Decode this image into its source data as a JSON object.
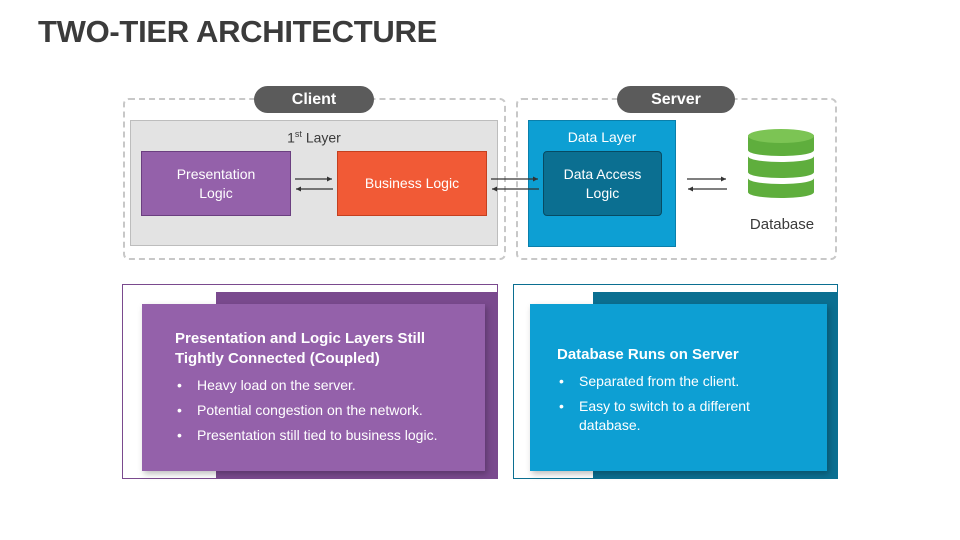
{
  "title": "TWO-TIER ARCHITECTURE",
  "client": {
    "label": "Client",
    "layer_label_pre": "1",
    "layer_label_sup": "st",
    "layer_label_post": " Layer",
    "presentation": "Presentation Logic",
    "business": "Business Logic"
  },
  "server": {
    "label": "Server",
    "layer_label": "Data Layer",
    "data_access": "Data Access Logic",
    "database": "Database"
  },
  "cards": {
    "left": {
      "title": "Presentation and Logic Layers Still Tightly Connected (Coupled)",
      "items": [
        "Heavy load on the server.",
        "Potential congestion on the network.",
        "Presentation still tied to business logic."
      ]
    },
    "right": {
      "title": "Database Runs on Server",
      "items": [
        "Separated from the client.",
        "Easy to switch to a different database."
      ]
    }
  },
  "colors": {
    "purple": "#9461aa",
    "orange": "#f15a36",
    "blue": "#0d9fd3",
    "teal": "#0b6f91",
    "green": "#5fae3d",
    "dark_gray": "#5b5b5b"
  }
}
